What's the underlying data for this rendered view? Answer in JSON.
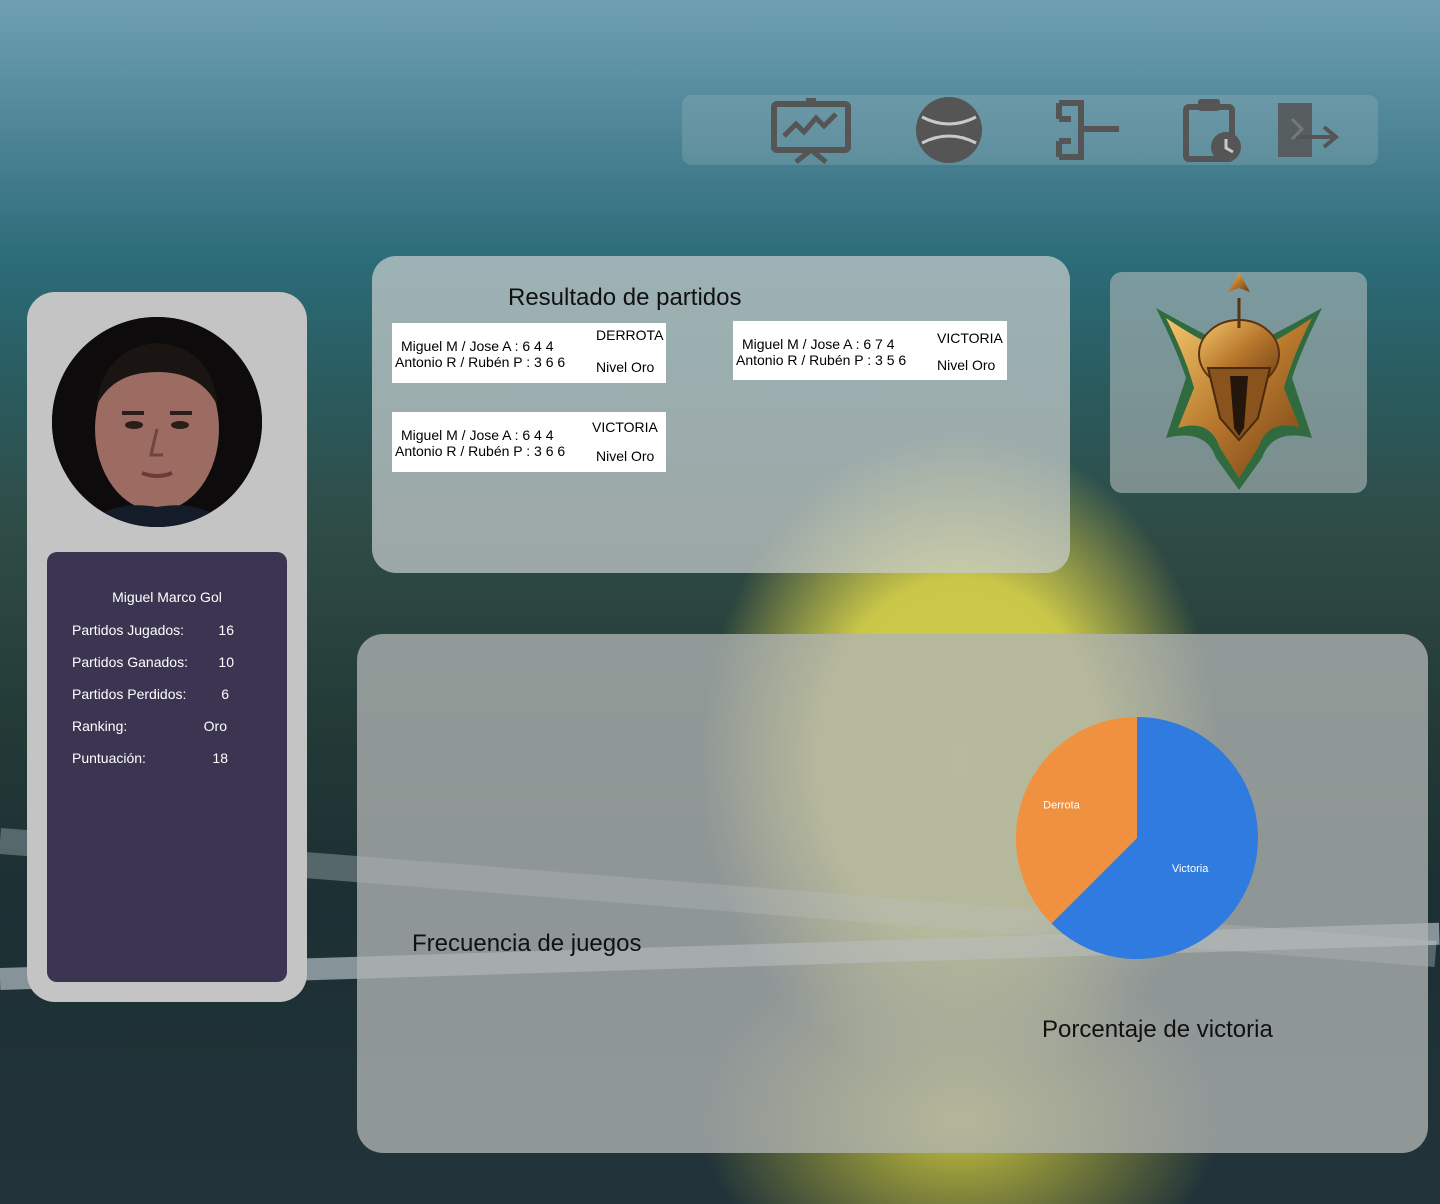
{
  "navbar": {
    "icons": [
      {
        "name": "presentation-chart-icon"
      },
      {
        "name": "baseball-icon"
      },
      {
        "name": "bracket-icon"
      },
      {
        "name": "clipboard-clock-icon"
      },
      {
        "name": "logout-icon"
      }
    ],
    "icon_color": "#555555"
  },
  "profile": {
    "name": "Miguel Marco Gol",
    "stats": [
      {
        "label": "Partidos Jugados:",
        "value": "16"
      },
      {
        "label": "Partidos Ganados:",
        "value": "10"
      },
      {
        "label": "Partidos Perdidos:",
        "value": "6"
      },
      {
        "label": "Ranking:",
        "value": "Oro"
      },
      {
        "label": "Puntuación:",
        "value": "18"
      }
    ],
    "panel_color": "#3b3551"
  },
  "results": {
    "title": "Resultado de partidos",
    "matches": [
      {
        "team1": "Miguel M / Jose A : 6  4  4",
        "team2": "Antonio R / Rubén P : 3  6  6",
        "result": "DERROTA",
        "level": "Nivel Oro"
      },
      {
        "team1": "Miguel M / Jose A : 6  7  4",
        "team2": "Antonio R / Rubén P : 3  5  6",
        "result": "VICTORIA",
        "level": "Nivel Oro"
      },
      {
        "team1": "Miguel M / Jose A : 6  4  4",
        "team2": "Antonio R / Rubén P : 3  6  6",
        "result": "VICTORIA",
        "level": "Nivel Oro"
      }
    ]
  },
  "rank_badge": {
    "name": "gold-rank-emblem-icon"
  },
  "charts": {
    "frequency_title": "Frecuencia de juegos",
    "percentage_title": "Porcentaje de victoria"
  },
  "chart_data": {
    "type": "pie",
    "title": "Porcentaje de victoria",
    "slices": [
      {
        "label": "Victoria",
        "value": 10,
        "color": "#2f7be0"
      },
      {
        "label": "Derrota",
        "value": 6,
        "color": "#f0913f"
      }
    ]
  }
}
